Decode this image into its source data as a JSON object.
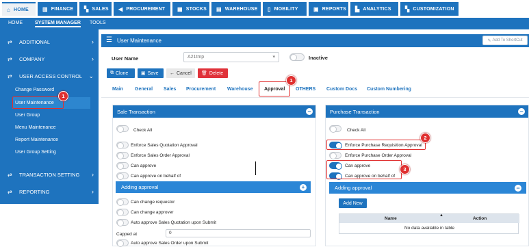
{
  "top_nav": {
    "home": "HOME",
    "finance": "FINANCE",
    "sales": "SALES",
    "procurement": "PROCUREMENT",
    "stocks": "STOCKS",
    "warehouse": "WAREHOUSE",
    "mobility": "MOBILITY",
    "reports": "REPORTS",
    "analytics": "ANALYTICS",
    "customization": "CUSTOMIZATION"
  },
  "sub_nav": {
    "home": "HOME",
    "system_manager": "SYSTEM MANAGER",
    "tools": "TOOLS"
  },
  "sidebar": {
    "additional": "ADDITIONAL",
    "company": "COMPANY",
    "user_access_control": "USER ACCESS CONTROL",
    "items": [
      "Change Password",
      "User Maintenance",
      "User Group",
      "Menu Maintenance",
      "Report Maintenance",
      "User Group Setting"
    ],
    "transaction_setting": "TRANSACTION SETTING",
    "reporting": "REPORTING"
  },
  "header": {
    "title": "User Maintenance",
    "shortcut": "Add To ShortCut"
  },
  "form": {
    "user_name_label": "User Name",
    "user_name_value": "A21tmp",
    "inactive_label": "Inactive"
  },
  "toolbar": {
    "clone": "Clone",
    "save": "Save",
    "cancel": "Cancel",
    "delete": "Delete"
  },
  "tabs": [
    "Main",
    "General",
    "Sales",
    "Procurement",
    "Warehouse",
    "Approval",
    "OTHERS",
    "Custom Docs",
    "Custom Numbering"
  ],
  "sale_panel": {
    "title": "Sale Transaction",
    "check_all": "Check All",
    "options": [
      "Enforce Sales Quotation Approval",
      "Enforce Sales Order Approval",
      "Can approve",
      "Can approve on behalf of"
    ],
    "adding_approval": "Adding approval",
    "adding_options": [
      "Can change requestor",
      "Can change approver",
      "Auto approve Sales Quotation upon Submit"
    ],
    "capped_at_label": "Capped at",
    "capped_at_value": "0",
    "last_option": "Auto approve Sales Order upon Submit"
  },
  "purchase_panel": {
    "title": "Purchase Transaction",
    "check_all": "Check All",
    "options": [
      "Enforce Purchase Requisition Approval",
      "Enforce Purchase Order Approval",
      "Can approve",
      "Can approve on behalf of"
    ],
    "adding_approval": "Adding approval",
    "add_new": "Add New",
    "table_headers": {
      "name": "Name",
      "action": "Action"
    },
    "empty_text": "No data available in table"
  },
  "badges": [
    "1",
    "1",
    "2",
    "3"
  ],
  "colors": {
    "primary": "#1e73be",
    "save": "#1e73be",
    "delete": "#e0323a",
    "annotation": "#e03030"
  }
}
